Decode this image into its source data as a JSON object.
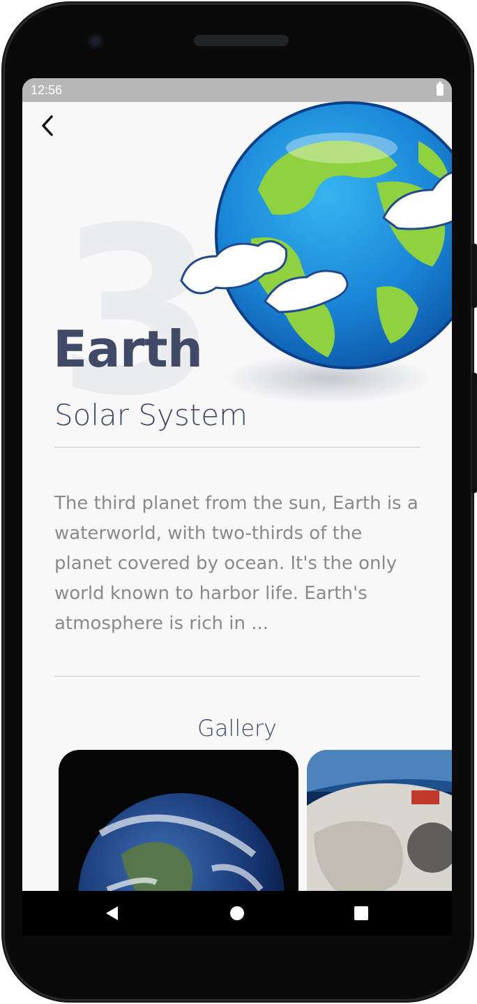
{
  "status_bar": {
    "time": "12:56"
  },
  "planet": {
    "order_number": "3",
    "name": "Earth",
    "category": "Solar System",
    "description": "The third planet from the sun, Earth is a waterworld, with two-thirds of the planet covered by ocean. It's the only world known to harbor life. Earth's atmosphere is rich in ..."
  },
  "gallery": {
    "title": "Gallery",
    "images": [
      {
        "icon": "earth-photo"
      },
      {
        "icon": "astronaut-photo"
      }
    ]
  },
  "nav_bar": {
    "icons": [
      "back-triangle-icon",
      "home-circle-icon",
      "recents-square-icon"
    ]
  },
  "colors": {
    "title": "#404966",
    "body_text": "#8a8a8a",
    "background": "#f8f8f8"
  }
}
